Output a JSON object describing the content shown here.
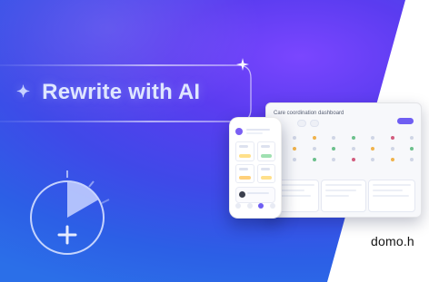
{
  "banner": {
    "headline": "Rewrite with AI",
    "domain": "domo.h",
    "colors": {
      "gradient_a": "#7a46ff",
      "gradient_b": "#2b6fe8",
      "headline": "#dfe6ff",
      "accent": "#6f5ef2"
    },
    "icons": {
      "sparkle": "sparkle-icon",
      "timer": "timer-plus-icon",
      "star": "four-point-star-icon"
    }
  },
  "dashboard": {
    "title": "Care coordination dashboard"
  }
}
